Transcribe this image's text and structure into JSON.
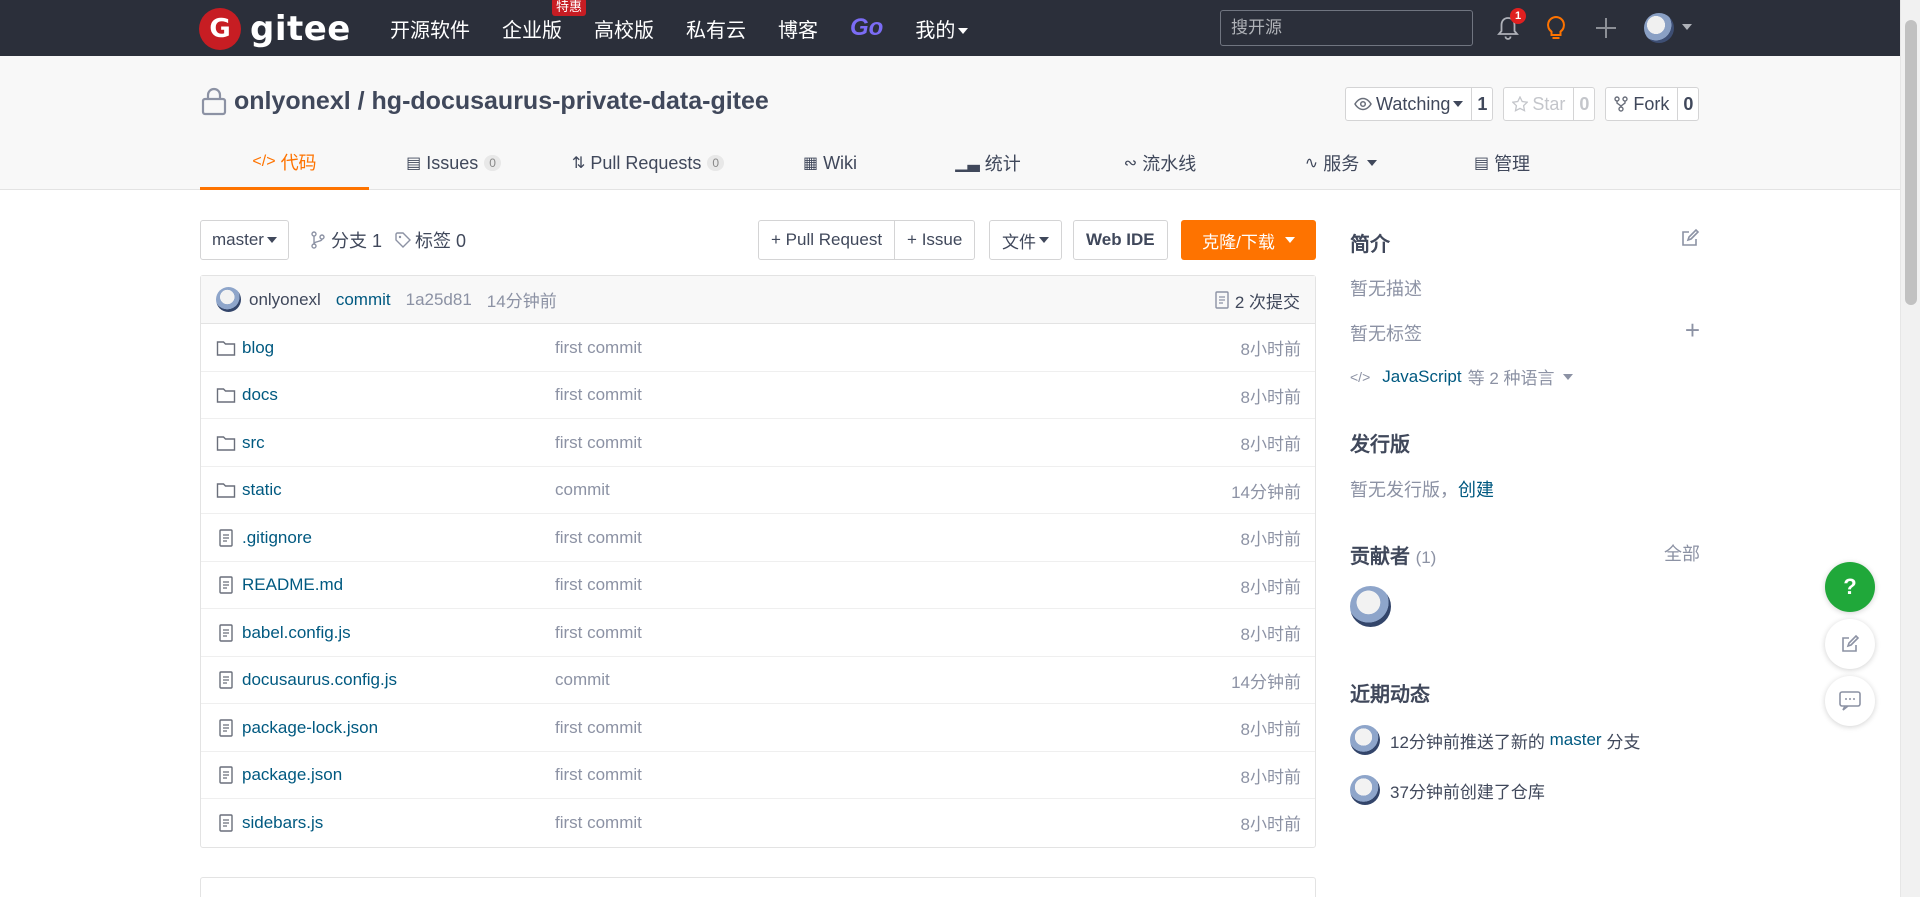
{
  "topnav": {
    "logo_mark": "G",
    "logo_text": "gitee",
    "items": [
      {
        "label": "开源软件"
      },
      {
        "label": "企业版",
        "badge": "特惠"
      },
      {
        "label": "高校版"
      },
      {
        "label": "私有云"
      },
      {
        "label": "博客"
      },
      {
        "label": "Go"
      },
      {
        "label": "我的"
      }
    ],
    "search_placeholder": "搜开源",
    "notification_count": "1"
  },
  "repo": {
    "owner": "onlyonexl",
    "separator": " / ",
    "name": "hg-docusaurus-private-data-gitee",
    "watching_label": "Watching",
    "watching_count": "1",
    "star_label": "Star",
    "star_count": "0",
    "fork_label": "Fork",
    "fork_count": "0"
  },
  "tabs": [
    {
      "label": "代码",
      "icon": "</>"
    },
    {
      "label": "Issues",
      "count": "0"
    },
    {
      "label": "Pull Requests",
      "count": "0"
    },
    {
      "label": "Wiki"
    },
    {
      "label": "统计"
    },
    {
      "label": "流水线"
    },
    {
      "label": "服务"
    },
    {
      "label": "管理"
    }
  ],
  "toolbar": {
    "branch": "master",
    "branches": "分支 1",
    "tags": "标签 0",
    "pull_request": "+ Pull Request",
    "issue": "+ Issue",
    "file": "文件",
    "web_ide": "Web IDE",
    "clone": "克隆/下载"
  },
  "commit": {
    "author": "onlyonexl",
    "message": "commit",
    "sha": "1a25d81",
    "time": "14分钟前",
    "count": "2 次提交"
  },
  "files": [
    {
      "name": "blog",
      "type": "folder",
      "message": "first commit",
      "time": "8小时前"
    },
    {
      "name": "docs",
      "type": "folder",
      "message": "first commit",
      "time": "8小时前"
    },
    {
      "name": "src",
      "type": "folder",
      "message": "first commit",
      "time": "8小时前"
    },
    {
      "name": "static",
      "type": "folder",
      "message": "commit",
      "time": "14分钟前"
    },
    {
      "name": ".gitignore",
      "type": "file",
      "message": "first commit",
      "time": "8小时前"
    },
    {
      "name": "README.md",
      "type": "file",
      "message": "first commit",
      "time": "8小时前"
    },
    {
      "name": "babel.config.js",
      "type": "file",
      "message": "first commit",
      "time": "8小时前"
    },
    {
      "name": "docusaurus.config.js",
      "type": "file",
      "message": "commit",
      "time": "14分钟前"
    },
    {
      "name": "package-lock.json",
      "type": "file",
      "message": "first commit",
      "time": "8小时前"
    },
    {
      "name": "package.json",
      "type": "file",
      "message": "first commit",
      "time": "8小时前"
    },
    {
      "name": "sidebars.js",
      "type": "file",
      "message": "first commit",
      "time": "8小时前"
    }
  ],
  "sidebar": {
    "intro_title": "简介",
    "no_desc": "暂无描述",
    "no_tags": "暂无标签",
    "lang_prefix": "JavaScript",
    "lang_suffix": "等 2 种语言",
    "release_title": "发行版",
    "no_release": "暂无发行版，",
    "create": "创建",
    "contrib_title": "贡献者",
    "contrib_count": "(1)",
    "all": "全部",
    "activity_title": "近期动态",
    "activities": [
      {
        "prefix": "12分钟前推送了新的 ",
        "branch": "master",
        "suffix": " 分支"
      },
      {
        "prefix": "37分钟前创建了仓库",
        "branch": "",
        "suffix": ""
      }
    ]
  },
  "floating": {
    "help": "?"
  }
}
